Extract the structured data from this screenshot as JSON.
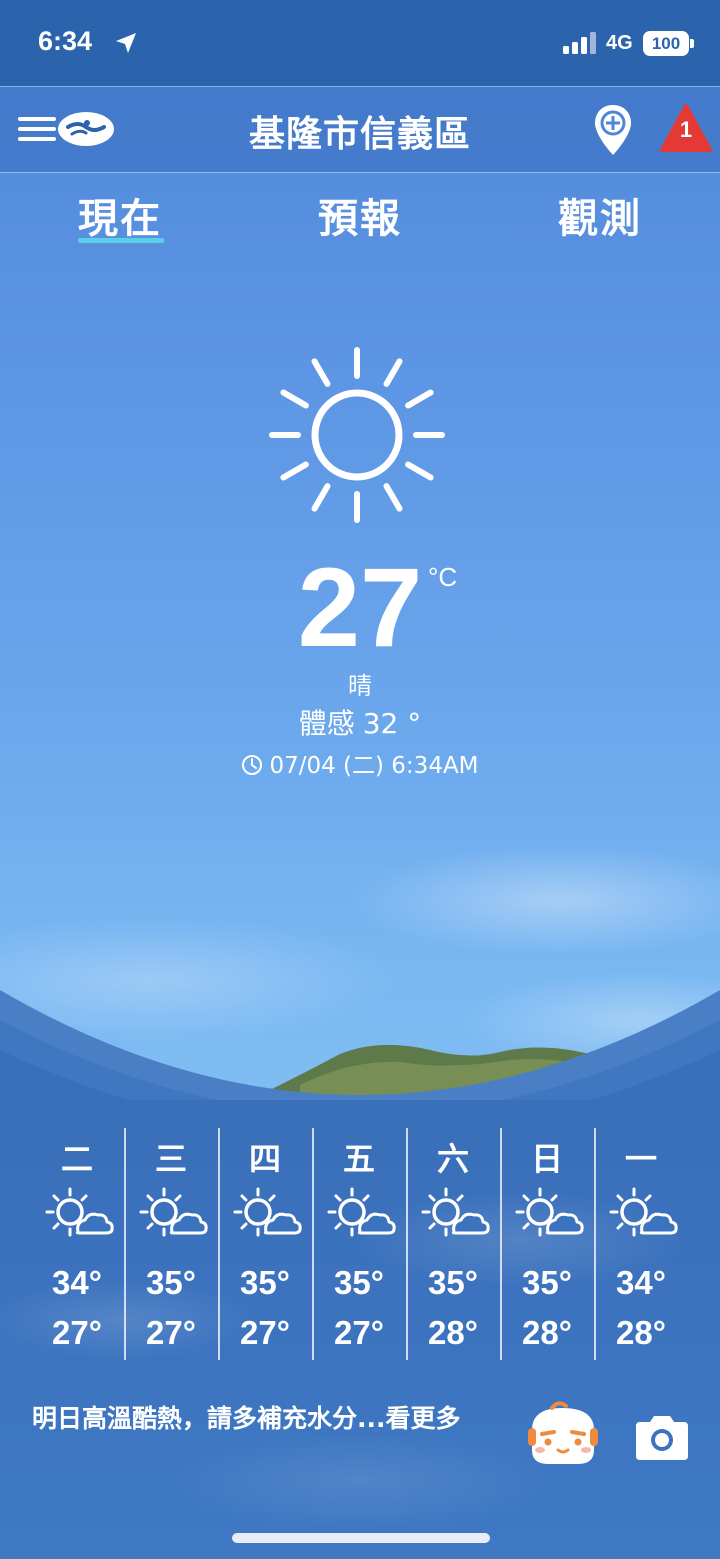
{
  "status_bar": {
    "time": "6:34",
    "network": "4G",
    "battery": "100",
    "location_icon": "location-arrow-icon",
    "signal_icon": "cellular-signal-icon"
  },
  "header": {
    "title": "基隆市信義區",
    "menu_icon": "hamburger-menu-icon",
    "logo_icon": "cwa-logo-icon",
    "add_location_icon": "add-location-pin-icon",
    "alert_icon": "warning-triangle-icon",
    "alert_count": "1",
    "alert_color": "#e53935"
  },
  "tabs": [
    {
      "label": "現在",
      "active": true
    },
    {
      "label": "預報",
      "active": false
    },
    {
      "label": "觀測",
      "active": false
    }
  ],
  "current": {
    "icon": "sun-icon",
    "temperature": "27",
    "unit": "°C",
    "condition": "晴",
    "feels_like_label": "體感",
    "feels_like_value": "32 °",
    "observed_time": "07/04 (二) 6:34AM"
  },
  "week": [
    {
      "day": "二",
      "high": "34°",
      "low": "27°",
      "icon": "sunny-cloudy-icon"
    },
    {
      "day": "三",
      "high": "35°",
      "low": "27°",
      "icon": "sunny-cloudy-icon"
    },
    {
      "day": "四",
      "high": "35°",
      "low": "27°",
      "icon": "sunny-cloudy-icon"
    },
    {
      "day": "五",
      "high": "35°",
      "low": "27°",
      "icon": "sunny-cloudy-icon"
    },
    {
      "day": "六",
      "high": "35°",
      "low": "28°",
      "icon": "sunny-cloudy-icon"
    },
    {
      "day": "日",
      "high": "35°",
      "low": "28°",
      "icon": "sunny-cloudy-icon"
    },
    {
      "day": "一",
      "high": "34°",
      "low": "28°",
      "icon": "sunny-cloudy-icon"
    }
  ],
  "tip": "明日高溫酷熱，請多補充水分...看更多",
  "bottom_actions": {
    "assistant_icon": "mascot-assistant-icon",
    "camera_icon": "camera-icon"
  }
}
